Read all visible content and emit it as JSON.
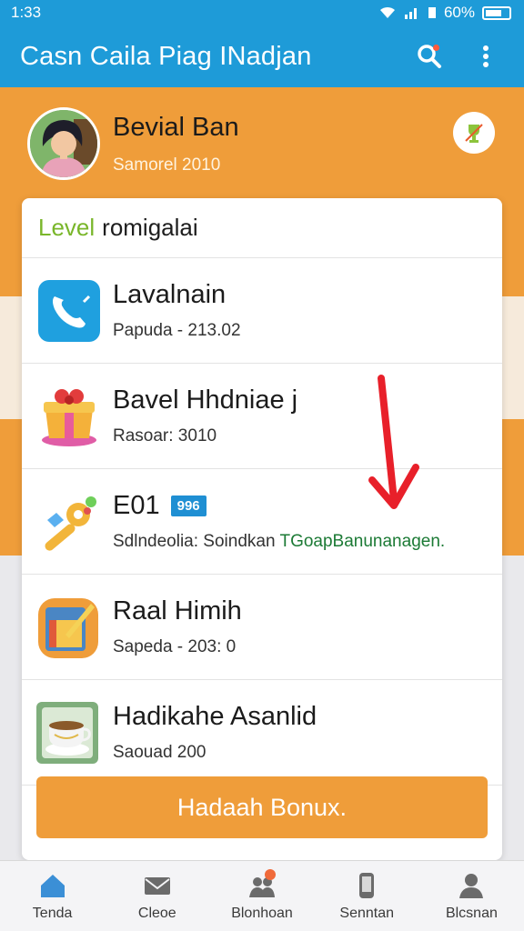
{
  "status": {
    "time": "1:33",
    "battery": "60%"
  },
  "app": {
    "title": "Casn Caila Piag INadjan",
    "accent": "#1e9bd8",
    "orange": "#ef9d3a"
  },
  "profile": {
    "name": "Bevial Ban",
    "subtitle": "Samorel 2010"
  },
  "card": {
    "level_word": "Level",
    "level_rest": "romigalai",
    "items": [
      {
        "title": "Lavalnain",
        "subtitle": "Papuda - 213.02",
        "icon": "phone-app-icon"
      },
      {
        "title": "Bavel Hhdniae j",
        "subtitle": "Rasoar: 3010",
        "icon": "gift-box-icon"
      },
      {
        "title": "E01",
        "tag": "996",
        "subtitle_a": "Sdlndeolia: Soindkan",
        "subtitle_b": "TGoapBanunanagen.",
        "icon": "key-icon"
      },
      {
        "title": "Raal Himih",
        "subtitle": "Sapeda - 203: 0",
        "icon": "paint-box-icon"
      },
      {
        "title": "Hadikahe Asanlid",
        "subtitle": "Saouad 200",
        "icon": "tea-cup-icon"
      }
    ],
    "bonus_label": "Hadaah Bonux."
  },
  "nav": [
    {
      "label": "Tenda",
      "icon": "home-icon"
    },
    {
      "label": "Cleoe",
      "icon": "mail-icon"
    },
    {
      "label": "Blonhoan",
      "icon": "people-icon"
    },
    {
      "label": "Senntan",
      "icon": "phone-icon"
    },
    {
      "label": "Blcsnan",
      "icon": "profile-icon"
    }
  ]
}
